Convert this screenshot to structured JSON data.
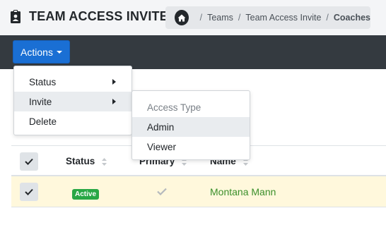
{
  "header": {
    "title": "TEAM ACCESS INVITE",
    "breadcrumb": [
      "Teams",
      "Team Access Invite",
      "Coaches"
    ],
    "separator": "/"
  },
  "toolbar": {
    "actions_label": "Actions"
  },
  "dropdown": {
    "items": [
      {
        "label": "Status",
        "has_submenu": true
      },
      {
        "label": "Invite",
        "has_submenu": true,
        "active": true
      },
      {
        "label": "Delete",
        "has_submenu": false
      }
    ]
  },
  "submenu": {
    "header": "Access Type",
    "items": [
      {
        "label": "Admin",
        "active": true
      },
      {
        "label": "Viewer"
      }
    ]
  },
  "table": {
    "columns": [
      "Status",
      "Primary",
      "Name"
    ],
    "rows": [
      {
        "status": "Active",
        "primary": true,
        "name": "Montana Mann",
        "selected": true
      }
    ]
  },
  "colors": {
    "accent": "#1a6fd4",
    "toolbar_bg": "#343a40",
    "success": "#28a745",
    "selected_row": "#fff8dc"
  },
  "icons": {
    "title": "clipboard-badge-icon",
    "home": "home-icon",
    "check": "check-icon",
    "sort": "sort-icon"
  }
}
